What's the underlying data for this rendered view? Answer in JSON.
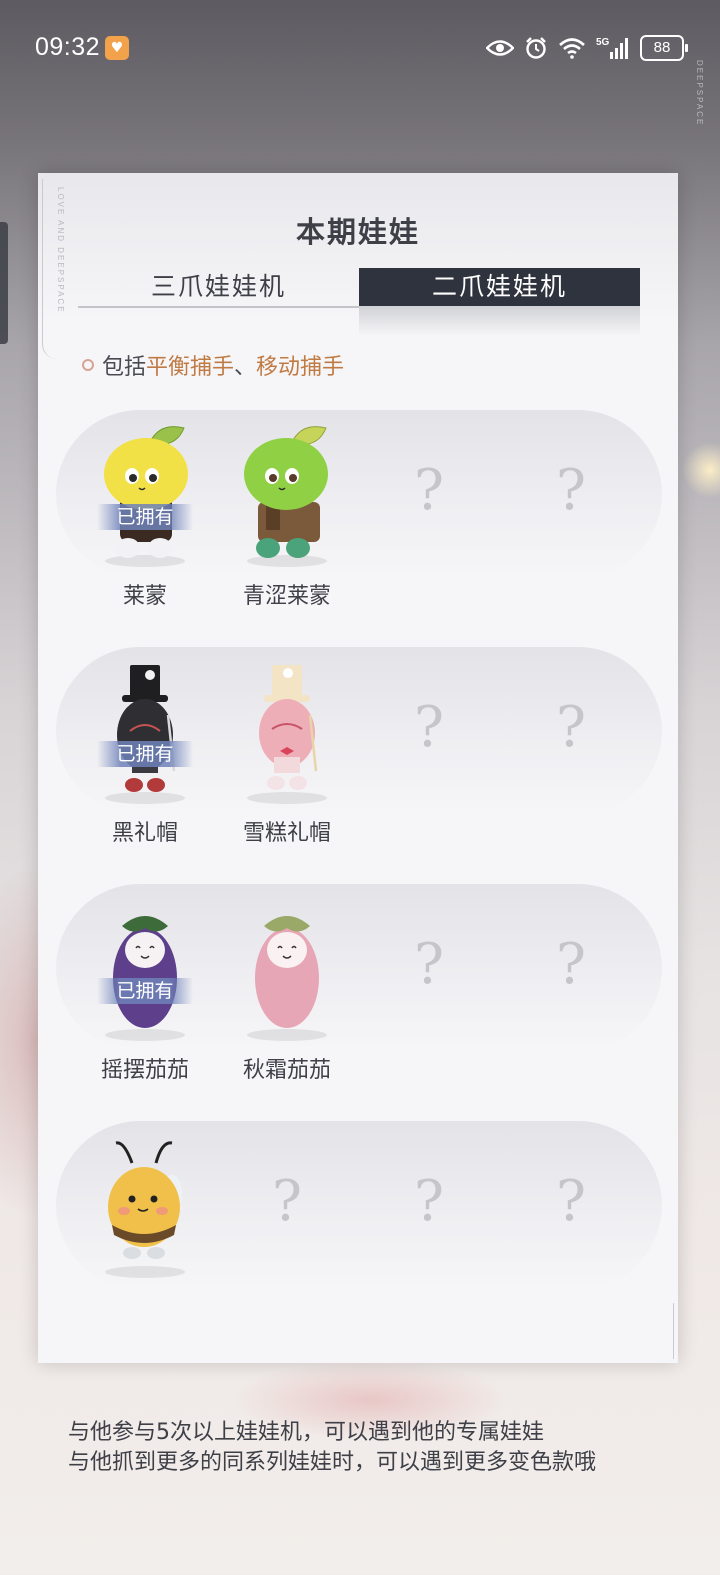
{
  "status_bar": {
    "time": "09:32",
    "network": "5G",
    "battery": "88",
    "icons": [
      "eye-icon",
      "alarm-icon",
      "wifi-icon",
      "signal-icon",
      "battery-icon"
    ]
  },
  "panel": {
    "title": "本期娃娃",
    "tabs": [
      {
        "label": "三爪娃娃机",
        "active": false
      },
      {
        "label": "二爪娃娃机",
        "active": true
      }
    ],
    "includes": {
      "prefix": "包括",
      "item1": "平衡捕手",
      "separator": "、",
      "item2": "移动捕手"
    },
    "owned_label": "已拥有",
    "unknown_mark": "?",
    "rows": [
      {
        "items": [
          {
            "name": "莱蒙",
            "owned": true,
            "doll": "lemon-yellow"
          },
          {
            "name": "青涩莱蒙",
            "owned": false,
            "doll": "lemon-green"
          },
          {
            "unknown": true
          },
          {
            "unknown": true
          }
        ]
      },
      {
        "items": [
          {
            "name": "黑礼帽",
            "owned": true,
            "doll": "tophat-black"
          },
          {
            "name": "雪糕礼帽",
            "owned": false,
            "doll": "tophat-pink"
          },
          {
            "unknown": true
          },
          {
            "unknown": true
          }
        ]
      },
      {
        "items": [
          {
            "name": "摇摆茄茄",
            "owned": true,
            "doll": "eggplant-purple"
          },
          {
            "name": "秋霜茄茄",
            "owned": false,
            "doll": "eggplant-pink"
          },
          {
            "unknown": true
          },
          {
            "unknown": true
          }
        ]
      },
      {
        "items": [
          {
            "name": "",
            "owned": false,
            "doll": "bee"
          },
          {
            "unknown": true
          },
          {
            "unknown": true
          },
          {
            "unknown": true
          }
        ]
      }
    ]
  },
  "footer": {
    "line1": "与他参与5次以上娃娃机，可以遇到他的专属娃娃",
    "line2": "与他抓到更多的同系列娃娃时，可以遇到更多变色款哦"
  },
  "colors": {
    "tab_active_bg": "#2f333d",
    "highlight": "#c07b45",
    "owned_badge": "#6e82b9",
    "text": "#3e3f47"
  }
}
